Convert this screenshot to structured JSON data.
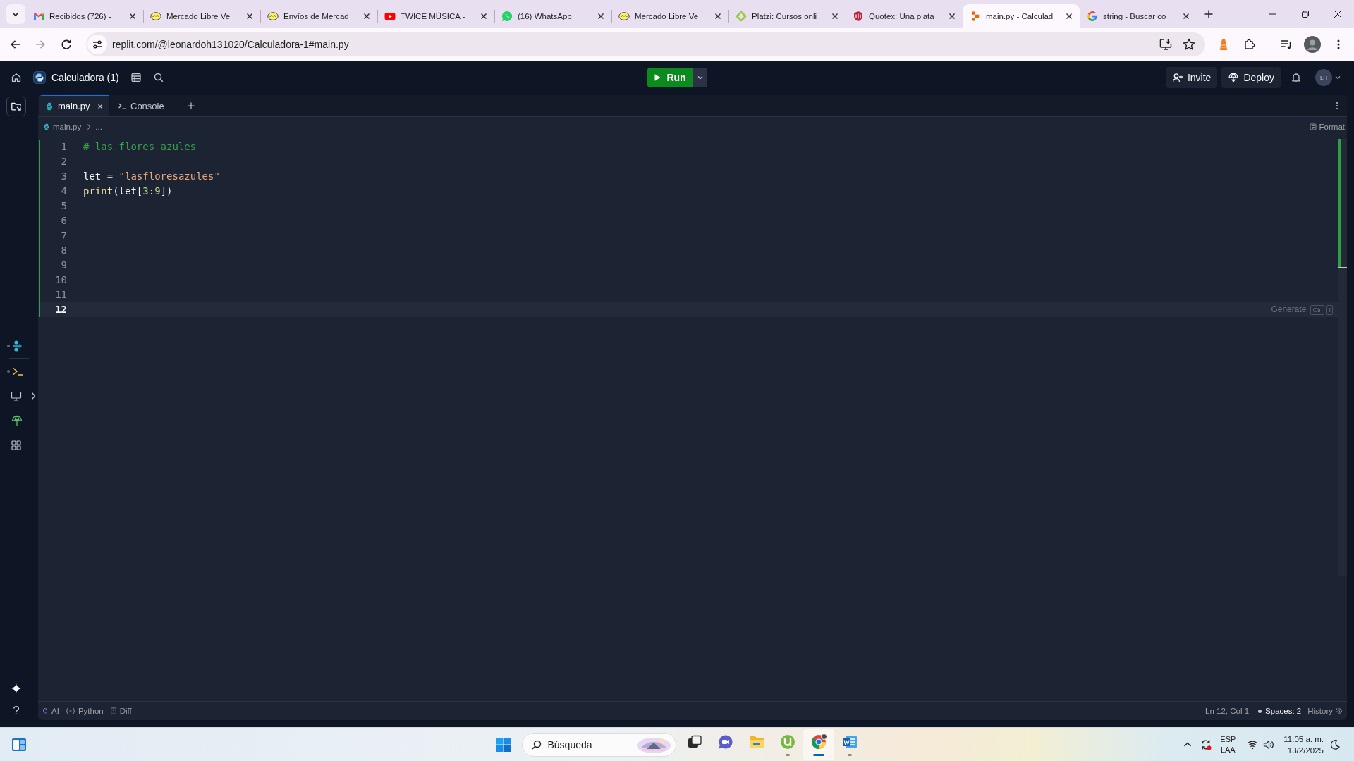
{
  "browser": {
    "tabs": [
      {
        "title": "Recibidos (726) -",
        "kind": "mail",
        "selected": false
      },
      {
        "title": "Mercado Libre Ve",
        "kind": "handshake",
        "selected": false
      },
      {
        "title": "Envíos de Mercad",
        "kind": "handshake",
        "selected": false
      },
      {
        "title": "TWICE MÚSICA -",
        "kind": "play",
        "selected": false
      },
      {
        "title": "(16) WhatsApp",
        "kind": "chat",
        "selected": false
      },
      {
        "title": "Mercado Libre Ve",
        "kind": "handshake",
        "selected": false
      },
      {
        "title": "Platzi: Cursos onli",
        "kind": "diamond",
        "selected": false
      },
      {
        "title": "Quotex: Una plata",
        "kind": "shield",
        "selected": false
      },
      {
        "title": "main.py - Calculad",
        "kind": "blocks",
        "selected": true
      },
      {
        "title": "string - Buscar co",
        "kind": "g",
        "selected": false
      }
    ],
    "forward_disabled": true,
    "url": "replit.com/@leonardoh131020/Calculadora-1#main.py"
  },
  "header": {
    "project": "Calculadora (1)",
    "run": "Run",
    "invite": "Invite",
    "deploy": "Deploy",
    "avatar": "LH"
  },
  "editor_tabs": [
    {
      "label": "main.py",
      "kind": "file",
      "selected": true
    },
    {
      "label": "Console",
      "kind": "console",
      "selected": false
    }
  ],
  "breadcrumb": {
    "file": "main.py",
    "more": "..."
  },
  "format": "Format",
  "lines": [
    {
      "number": "1",
      "selected": false,
      "tokens": [
        {
          "text": "# las flores azules",
          "kind": "comment"
        }
      ]
    },
    {
      "number": "2",
      "selected": false
    },
    {
      "number": "3",
      "selected": false,
      "tokens": [
        {
          "text": "let",
          "kind": "plain"
        },
        {
          "text": " = ",
          "kind": "operator"
        },
        {
          "text": "\"lasfloresazules\"",
          "kind": "string"
        }
      ]
    },
    {
      "number": "4",
      "selected": false,
      "tokens": [
        {
          "text": "print",
          "kind": "function"
        },
        {
          "text": "(let[",
          "kind": "plain"
        },
        {
          "text": "3",
          "kind": "number"
        },
        {
          "text": ":",
          "kind": "plain"
        },
        {
          "text": "9",
          "kind": "number"
        },
        {
          "text": "])",
          "kind": "plain"
        }
      ]
    },
    {
      "number": "5",
      "selected": false
    },
    {
      "number": "6",
      "selected": false
    },
    {
      "number": "7",
      "selected": false
    },
    {
      "number": "8",
      "selected": false
    },
    {
      "number": "9",
      "selected": false
    },
    {
      "number": "10",
      "selected": false
    },
    {
      "number": "11",
      "selected": false
    },
    {
      "number": "12",
      "selected": true
    }
  ],
  "generate": {
    "label": "Generate",
    "keys": [
      "Ctrl",
      "I"
    ]
  },
  "sidebar": {
    "help": "?"
  },
  "status_bar": {
    "items": [
      {
        "label": "AI",
        "kind": "ai"
      },
      {
        "label": "Python",
        "kind": "language"
      },
      {
        "label": "Diff",
        "kind": "diff"
      }
    ],
    "position": "Ln 12, Col 1",
    "indent": "Spaces: 2",
    "history": "History"
  },
  "taskbar": {
    "search_placeholder": "Búsqueda",
    "apps": [
      {
        "kind": "task-view",
        "running": false,
        "selected": false
      },
      {
        "kind": "video-chat",
        "running": false,
        "selected": false
      },
      {
        "kind": "folder",
        "running": false,
        "selected": false
      },
      {
        "kind": "download",
        "running": true,
        "selected": false
      },
      {
        "kind": "browser",
        "running": true,
        "selected": true
      },
      {
        "kind": "document",
        "running": true,
        "selected": false
      }
    ],
    "language": "ESP",
    "layout": "LAA",
    "time": "11:05 a. m.",
    "date": "13/2/2025"
  }
}
